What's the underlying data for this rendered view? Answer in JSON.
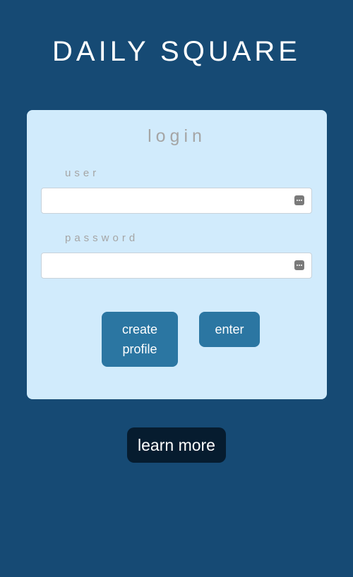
{
  "header": {
    "title": "DAILY SQUARE"
  },
  "login": {
    "title": "login",
    "user": {
      "label": "user",
      "value": "",
      "icon": "password-manager-key-icon"
    },
    "password": {
      "label": "password",
      "value": "",
      "icon": "password-manager-key-icon"
    },
    "create_profile_line1": "create",
    "create_profile_line2": "profile",
    "enter_label": "enter"
  },
  "footer": {
    "learn_more_label": "learn more"
  },
  "colors": {
    "background": "#164a74",
    "card": "#d1ebfc",
    "button": "#2b76a2",
    "learn_more_button": "#061c2f",
    "label_text": "#a5a5a5"
  }
}
